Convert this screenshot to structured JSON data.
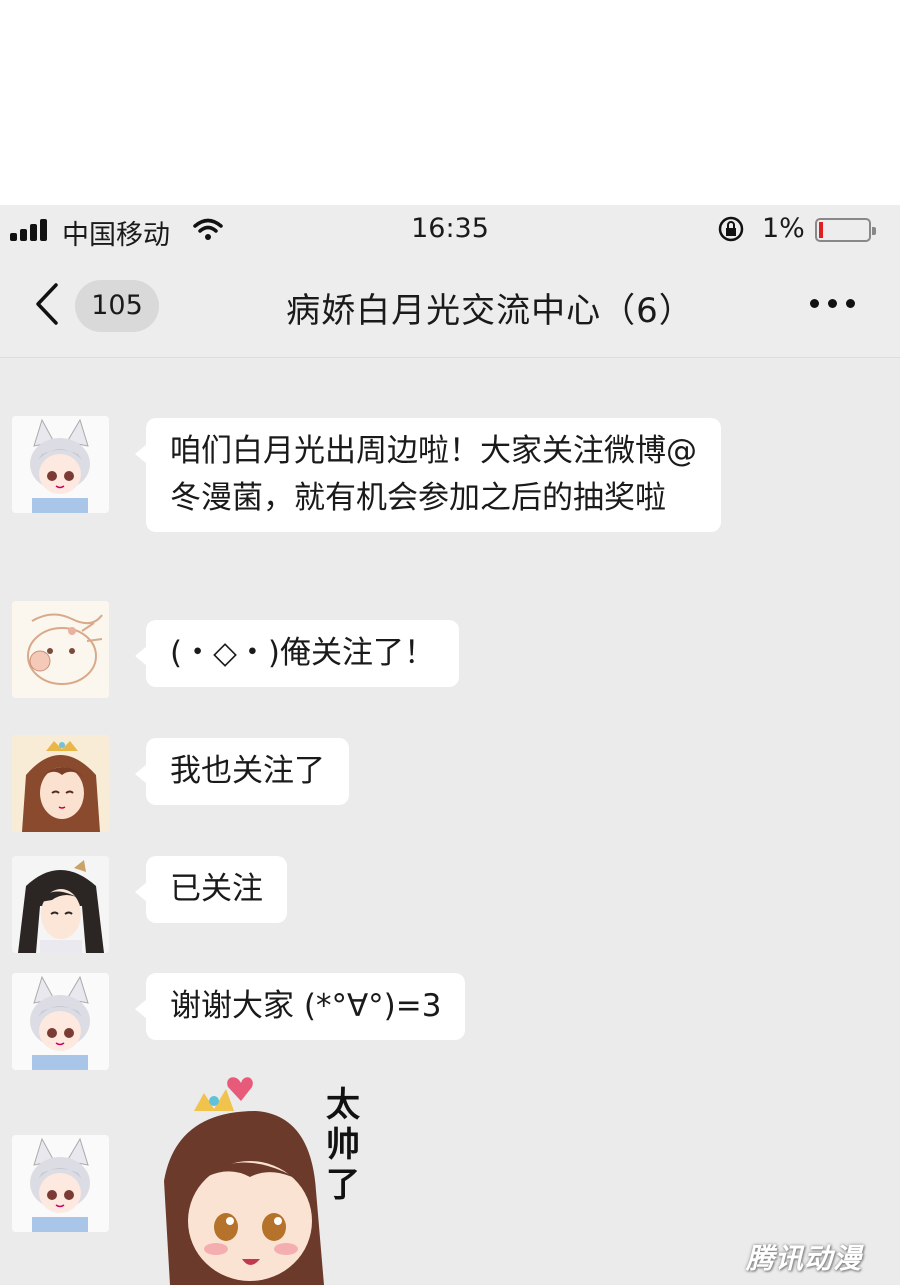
{
  "status_bar": {
    "carrier": "中国移动",
    "time": "16:35",
    "battery_percent": "1%",
    "icons": [
      "signal-icon",
      "wifi-icon",
      "orientation-lock-icon",
      "battery-icon"
    ],
    "battery_level": 0.01,
    "battery_color": "#e02020"
  },
  "nav_bar": {
    "unread_count": "105",
    "title": "病娇白月光交流中心（6）",
    "icons": [
      "chevron-left-icon",
      "more-icon"
    ]
  },
  "messages": [
    {
      "text": "咱们白月光出周边啦！大家关注微博@冬漫菌，就有机会参加之后的抽奖啦",
      "avatar": "silver-haired-fox-boy-avatar"
    },
    {
      "text": "(・◇・)俺关注了！",
      "avatar": "sketch-doodle-avatar"
    },
    {
      "text": "我也关注了",
      "avatar": "crowned-girl-avatar"
    },
    {
      "text": "已关注",
      "avatar": "dark-haired-man-avatar"
    },
    {
      "text": "谢谢大家 (*°∀°)=3",
      "avatar": "silver-haired-fox-boy-avatar"
    }
  ],
  "sticker": {
    "caption": "太帅了",
    "avatar": "silver-haired-fox-boy-avatar",
    "image": "blushing-girl-sticker"
  },
  "watermark": "腾讯动漫",
  "colors": {
    "chat_background": "#ebebeb",
    "bubble": "#ffffff",
    "nav_background": "#ededed"
  }
}
